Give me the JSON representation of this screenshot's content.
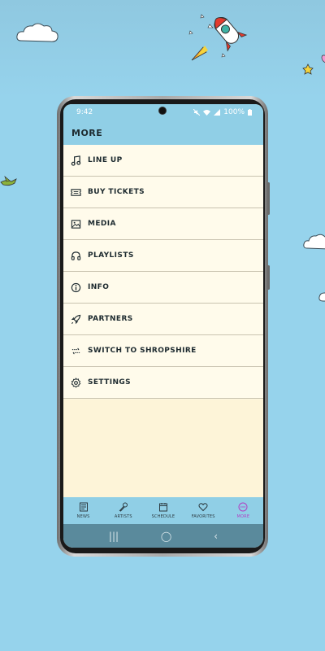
{
  "status": {
    "time": "9:42",
    "battery": "100%"
  },
  "appbar": {
    "title": "MORE"
  },
  "menu": {
    "items": [
      {
        "label": "LINE UP",
        "icon": "music-note-icon"
      },
      {
        "label": "BUY TICKETS",
        "icon": "ticket-icon"
      },
      {
        "label": "MEDIA",
        "icon": "image-icon"
      },
      {
        "label": "PLAYLISTS",
        "icon": "headphones-icon"
      },
      {
        "label": "INFO",
        "icon": "info-icon"
      },
      {
        "label": "PARTNERS",
        "icon": "rocket-icon"
      },
      {
        "label": "SWITCH TO SHROPSHIRE",
        "icon": "switch-icon"
      },
      {
        "label": "SETTINGS",
        "icon": "gear-icon"
      }
    ]
  },
  "bottomnav": {
    "items": [
      {
        "label": "NEWS",
        "icon": "news-icon",
        "active": false
      },
      {
        "label": "ARTISTS",
        "icon": "microphone-icon",
        "active": false
      },
      {
        "label": "SCHEDULE",
        "icon": "calendar-icon",
        "active": false
      },
      {
        "label": "FAVORITES",
        "icon": "heart-icon",
        "active": false
      },
      {
        "label": "MORE",
        "icon": "more-icon",
        "active": true
      }
    ]
  },
  "colors": {
    "sky": "#96d3ec",
    "appbar": "#90cfe6",
    "menu_bg": "#fffbeb",
    "active": "#b13fc3",
    "text": "#1d2a2f"
  }
}
